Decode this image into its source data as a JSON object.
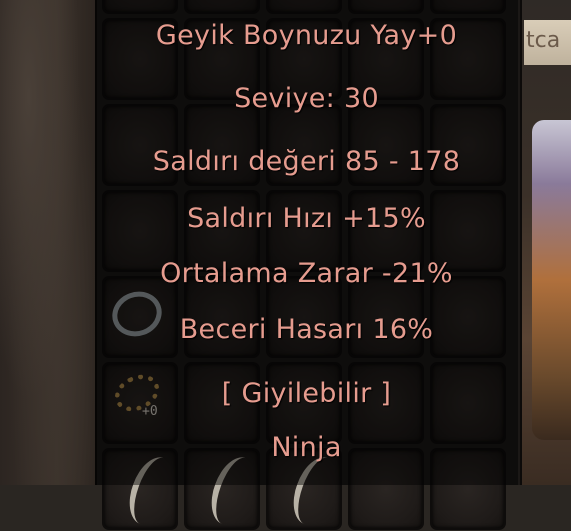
{
  "background": {
    "right_panel_text": "tca"
  },
  "tooltip": {
    "item_name": "Geyik Boynuzu Yay+0",
    "level": "Seviye: 30",
    "attack_value": "Saldırı değeri 85 - 178",
    "attack_speed": "Saldırı Hızı +15%",
    "average_damage": "Ortalama Zarar -21%",
    "skill_damage": "Beceri Hasarı 16%",
    "wearable": "[ Giyilebilir ]",
    "class": "Ninja"
  },
  "inventory": {
    "bracelet_upgrade": "+0"
  },
  "colors": {
    "tooltip_text": "#e69c8f",
    "slot_border": "#0e0c0b"
  }
}
